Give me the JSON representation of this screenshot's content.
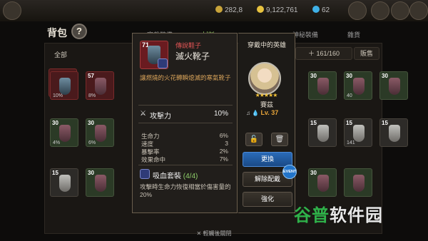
{
  "topbar": {
    "currency_1": "282,8",
    "currency_2": "9,122,761",
    "currency_3": "62"
  },
  "bag": {
    "title": "背包",
    "help_label": "?",
    "tabs": [
      {
        "label": "穿戴裝備",
        "active": false
      },
      {
        "label": "材料",
        "active": true
      },
      {
        "label": "",
        "active": false
      },
      {
        "label": "神秘裝備",
        "active": false
      },
      {
        "label": "雜貨",
        "active": false
      }
    ],
    "filter_all": "全部",
    "capacity": "161/160",
    "sort_label": "販售",
    "bottom_hint": "✕ 輕觸後關閉"
  },
  "slots": [
    {
      "level": "",
      "value": "",
      "style": "red"
    },
    {
      "level": "",
      "value": "10%",
      "style": "red"
    },
    {
      "level": "57",
      "value": "8%",
      "style": "red"
    },
    {
      "level": "",
      "value": "",
      "style": "green"
    },
    {
      "level": "30",
      "value": "",
      "style": "green"
    },
    {
      "level": "30",
      "value": "40",
      "style": "green"
    },
    {
      "level": "30",
      "value": "",
      "style": "green"
    },
    {
      "level": "30",
      "value": "",
      "style": "green"
    },
    {
      "level": "30",
      "value": "4%",
      "style": "green"
    },
    {
      "level": "30",
      "value": "6%",
      "style": "green"
    },
    {
      "level": "15",
      "value": "141",
      "style": "gray"
    },
    {
      "level": "15",
      "value": "",
      "style": "gray"
    },
    {
      "level": "15",
      "value": "",
      "style": "gray"
    },
    {
      "level": "15",
      "value": "",
      "style": "gray"
    }
  ],
  "tooltip": {
    "item_level": "71",
    "rarity": "傳說鞋子",
    "name": "滅火靴子",
    "description": "讓燃燒的火花轉瞬熄滅的寒氣靴子",
    "main_stat": {
      "label": "攻擊力",
      "value": "10%"
    },
    "substats": [
      {
        "label": "生命力",
        "value": "6%"
      },
      {
        "label": "速度",
        "value": "3"
      },
      {
        "label": "暴擊率",
        "value": "2%"
      },
      {
        "label": "效果命中",
        "value": "7%"
      }
    ],
    "set": {
      "name": "吸血套裝",
      "count": "(4/4)",
      "description": "攻擊時生命力恢復相當於傷害量的20%"
    }
  },
  "hero": {
    "title": "穿戴中的英雄",
    "stars": "★★★★★",
    "name": "賽茲",
    "level": "Lv. 37",
    "lock_icon": "lock-icon",
    "trash_icon": "trash-icon",
    "buttons": {
      "change": "更換",
      "unequip": "解除配戴",
      "enhance": "強化"
    },
    "event_label": "EVENT"
  },
  "watermark": {
    "part1": "谷普",
    "part2": "软件园"
  },
  "colors": {
    "accent_blue": "#2a6bb8",
    "rarity_red": "#e05454",
    "set_green": "#8fd06a",
    "level_orange": "#e8a53a"
  }
}
